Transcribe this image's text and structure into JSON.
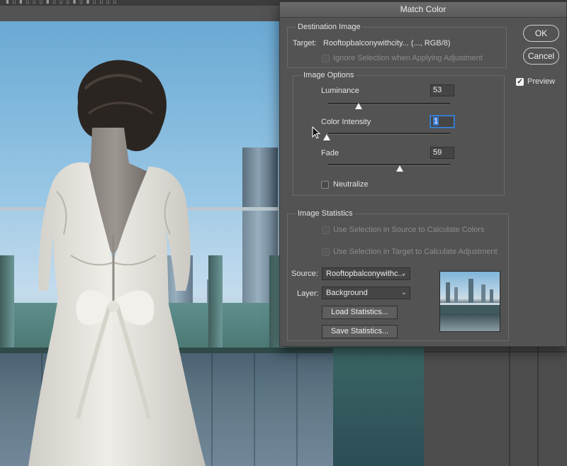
{
  "window_strip": {
    "text": "▮ ▯ ▮ ▯ ▯  ▯ ▮ ▯ ▯  ▯ ▮ ▯ ▮ ▯ ▯  ▯ ▯"
  },
  "dialog": {
    "title": "Match Color",
    "destination": {
      "section_title": "Destination Image",
      "target_label": "Target:",
      "target_value": "Rooftopbalconywithcity... (..., RGB/8)",
      "ignore_selection_label": "Ignore Selection when Applying Adjustment",
      "ignore_selection_checked": false
    },
    "image_options": {
      "section_title": "Image Options",
      "luminance": {
        "label": "Luminance",
        "value": "53",
        "level": 53,
        "max": 200
      },
      "color_intensity": {
        "label": "Color Intensity",
        "value": "1",
        "level": 1,
        "max": 200
      },
      "fade": {
        "label": "Fade",
        "value": "59",
        "level": 59,
        "max": 100
      },
      "neutralize_label": "Neutralize",
      "neutralize_checked": false
    },
    "image_statistics": {
      "section_title": "Image Statistics",
      "use_source_label": "Use Selection in Source to Calculate Colors",
      "use_target_label": "Use Selection in Target to Calculate Adjustment",
      "source_label": "Source:",
      "source_value": "Rooftopbalconywithc...",
      "layer_label": "Layer:",
      "layer_value": "Background",
      "load_button": "Load Statistics...",
      "save_button": "Save Statistics..."
    },
    "ok_button": "OK",
    "cancel_button": "Cancel",
    "preview_label": "Preview",
    "preview_checked": true
  },
  "icons": {
    "check": "✓",
    "chevron": "⌄"
  }
}
